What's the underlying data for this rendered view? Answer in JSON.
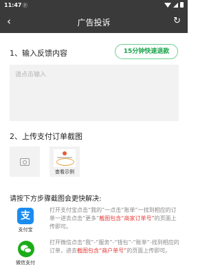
{
  "status_bar": {
    "time": "11:47",
    "sys_icon": "ⓟ"
  },
  "nav": {
    "back_icon": "‹",
    "title": "广告投诉",
    "refresh_icon": "↻"
  },
  "section1": {
    "title": "1、输入反馈内容",
    "refund_badge": "15分钟快速退款",
    "placeholder": "请点击输入"
  },
  "section2": {
    "title": "2、上传支付订单截图",
    "example_label": "查看示例"
  },
  "guide": {
    "title": "请按下方步骤截图会更快解决:",
    "alipay": {
      "name": "支付宝",
      "text": "打开支付宝点击“我的”一点击“账单”一找到相应的订单一进去点击“更多”",
      "highlight": "截图包含“商家订单号”",
      "suffix": "的页面上传即可。"
    },
    "wechat": {
      "name": "微信支付",
      "text": "打开微信点击“我”-“服务”-“钱包”-“账单”-找到相应的订单，进去",
      "highlight": "截图包含“商户单号”",
      "suffix": "的页面上传即可。"
    }
  },
  "colors": {
    "accent_green": "#19a44a",
    "highlight_red": "#e53935",
    "alipay_blue": "#1a8cf0",
    "wechat_green": "#1aad19",
    "bar_dark": "#3a3a3a"
  }
}
